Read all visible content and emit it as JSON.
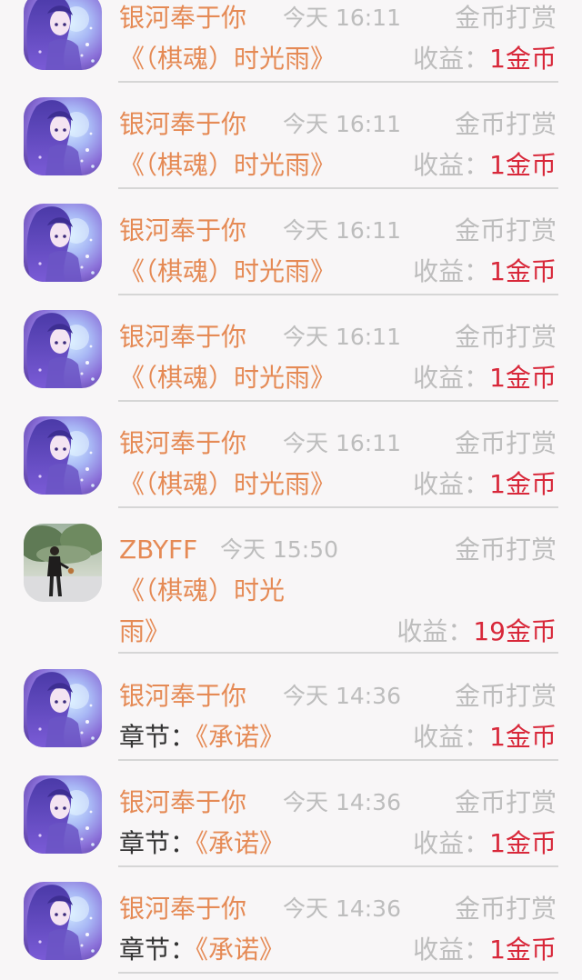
{
  "records": [
    {
      "user": "银河奉于你",
      "time": "今天 16:11",
      "type": "金币打赏",
      "prefix": "",
      "book": "《（棋魂）时光雨》",
      "book_line1": "",
      "book_line2": "",
      "income_label": "收益：",
      "income_value": "1金币",
      "avatar": "anime"
    },
    {
      "user": "银河奉于你",
      "time": "今天 16:11",
      "type": "金币打赏",
      "prefix": "",
      "book": "《（棋魂）时光雨》",
      "book_line1": "",
      "book_line2": "",
      "income_label": "收益：",
      "income_value": "1金币",
      "avatar": "anime"
    },
    {
      "user": "银河奉于你",
      "time": "今天 16:11",
      "type": "金币打赏",
      "prefix": "",
      "book": "《（棋魂）时光雨》",
      "book_line1": "",
      "book_line2": "",
      "income_label": "收益：",
      "income_value": "1金币",
      "avatar": "anime"
    },
    {
      "user": "银河奉于你",
      "time": "今天 16:11",
      "type": "金币打赏",
      "prefix": "",
      "book": "《（棋魂）时光雨》",
      "book_line1": "",
      "book_line2": "",
      "income_label": "收益：",
      "income_value": "1金币",
      "avatar": "anime"
    },
    {
      "user": "银河奉于你",
      "time": "今天 16:11",
      "type": "金币打赏",
      "prefix": "",
      "book": "《（棋魂）时光雨》",
      "book_line1": "",
      "book_line2": "",
      "income_label": "收益：",
      "income_value": "1金币",
      "avatar": "anime"
    },
    {
      "user": "ZBYFF",
      "time": "今天 15:50",
      "type": "金币打赏",
      "prefix": "",
      "book": "",
      "book_line1": "《（棋魂）时光",
      "book_line2": "雨》",
      "income_label": "收益：",
      "income_value": "19金币",
      "avatar": "photo"
    },
    {
      "user": "银河奉于你",
      "time": "今天 14:36",
      "type": "金币打赏",
      "prefix": "章节：",
      "book": "《承诺》",
      "book_line1": "",
      "book_line2": "",
      "income_label": "收益：",
      "income_value": "1金币",
      "avatar": "anime"
    },
    {
      "user": "银河奉于你",
      "time": "今天 14:36",
      "type": "金币打赏",
      "prefix": "章节：",
      "book": "《承诺》",
      "book_line1": "",
      "book_line2": "",
      "income_label": "收益：",
      "income_value": "1金币",
      "avatar": "anime"
    },
    {
      "user": "银河奉于你",
      "time": "今天 14:36",
      "type": "金币打赏",
      "prefix": "章节：",
      "book": "《承诺》",
      "book_line1": "",
      "book_line2": "",
      "income_label": "收益：",
      "income_value": "1金币",
      "avatar": "anime"
    }
  ]
}
